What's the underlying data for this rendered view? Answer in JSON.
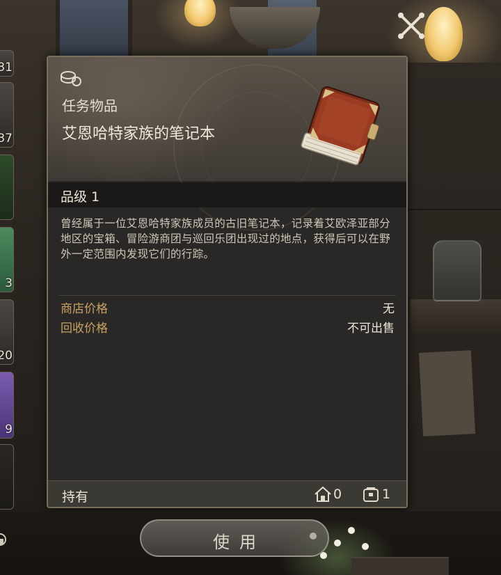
{
  "inventory_strip": {
    "slots": [
      {
        "count": "31",
        "color": "#4a4440"
      },
      {
        "count": "37",
        "color": "#4f4944"
      },
      {
        "count": "",
        "color": "#2f4a2a"
      },
      {
        "count": "3",
        "color": "#3f6d4c"
      },
      {
        "count": "20",
        "color": "#5b5550"
      },
      {
        "count": "9",
        "color": "#6a4b9c"
      },
      {
        "count": "",
        "color": "#2a2724"
      }
    ]
  },
  "close": {
    "icon": "close-x-icon"
  },
  "item": {
    "category": "任务物品",
    "name": "艾恩哈特家族的笔记本",
    "grade": "品级 1",
    "description": "曾经属于一位艾恩哈特家族成员的古旧笔记本，记录着艾欧泽亚部分地区的宝箱、冒险游商团与巡回乐团出现过的地点，获得后可以在野外一定范围内发现它们的行踪。",
    "prices": [
      {
        "label": "商店价格",
        "value": "无"
      },
      {
        "label": "回收价格",
        "value": "不可出售"
      }
    ],
    "holdings": {
      "label": "持有",
      "house_count": "0",
      "bag_count": "1"
    }
  },
  "actions": {
    "use_label": "使用"
  },
  "colors": {
    "accent_gold": "#c8a263",
    "panel_border": "#7a6e5c",
    "text_primary": "#ece4d6"
  }
}
